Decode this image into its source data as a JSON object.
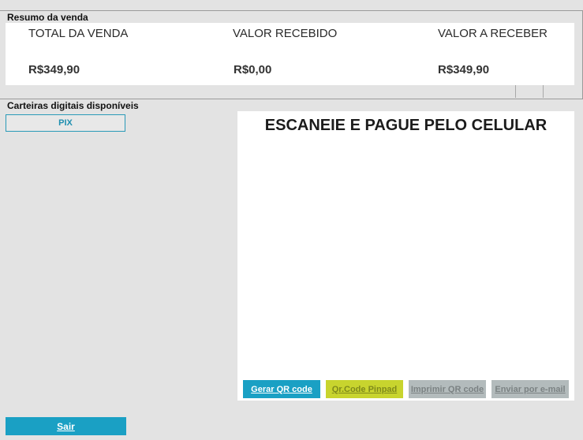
{
  "summary": {
    "section_label": "Resumo da venda",
    "total_label": "TOTAL DA VENDA",
    "total_value": "R$349,90",
    "received_label": "VALOR RECEBIDO",
    "received_value": "R$0,00",
    "receivable_label": "VALOR A RECEBER",
    "receivable_value": "R$349,90"
  },
  "wallets": {
    "section_label": "Carteiras digitais disponíveis",
    "items": [
      {
        "label": "PIX"
      }
    ]
  },
  "qr_panel": {
    "title": "ESCANEIE E PAGUE PELO CELULAR",
    "buttons": [
      {
        "label": "Gerar QR code",
        "state": "enabled"
      },
      {
        "label": "Qr.Code Pinpad",
        "state": "highlighted"
      },
      {
        "label": "Imprimir QR code",
        "state": "disabled"
      },
      {
        "label": "Enviar por e-mail",
        "state": "disabled"
      }
    ]
  },
  "footer": {
    "exit_label": "Sair"
  },
  "colors": {
    "accent": "#1aa0c4",
    "highlight": "#c8d42e",
    "disabled": "#b3bbbc",
    "background": "#e3e3e3"
  }
}
